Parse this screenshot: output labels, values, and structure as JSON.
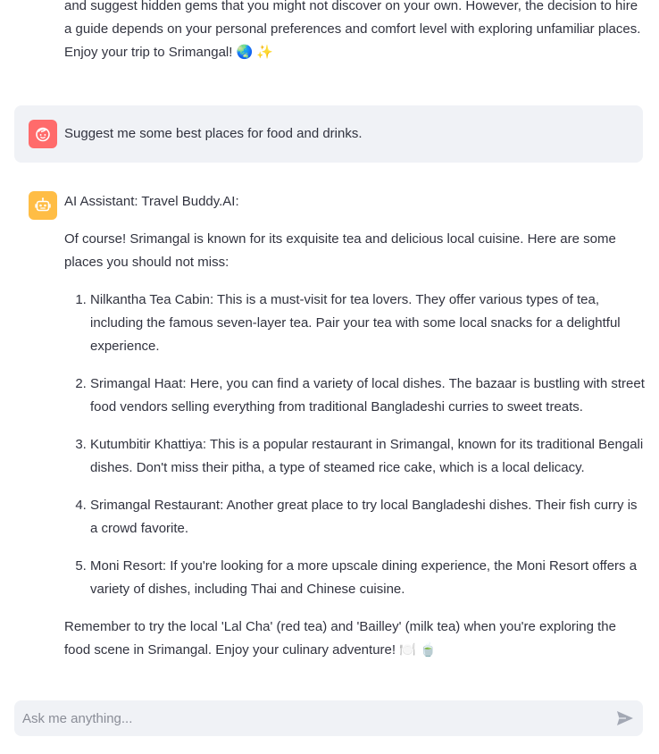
{
  "previous_message": {
    "lines": [
      "and suggest hidden gems that you might not discover on your own. However, the decision to hire",
      "a guide depends on your personal preferences and comfort level with exploring unfamiliar places.",
      "Enjoy your trip to Srimangal! 🌏 ✨"
    ]
  },
  "user_message": {
    "text": "Suggest me some best places for food and drinks.",
    "avatar_icon": "user-face-icon",
    "avatar_color": "#ff6b6b"
  },
  "assistant_message": {
    "avatar_icon": "robot-icon",
    "avatar_color": "#ffbd45",
    "header": "AI Assistant: Travel Buddy.AI:",
    "intro": "Of course! Srimangal is known for its exquisite tea and delicious local cuisine. Here are some places you should not miss:",
    "places": [
      "Nilkantha Tea Cabin: This is a must-visit for tea lovers. They offer various types of tea, including the famous seven-layer tea. Pair your tea with some local snacks for a delightful experience.",
      "Srimangal Haat: Here, you can find a variety of local dishes. The bazaar is bustling with street food vendors selling everything from traditional Bangladeshi curries to sweet treats.",
      "Kutumbitir Khattiya: This is a popular restaurant in Srimangal, known for its traditional Bengali dishes. Don't miss their pitha, a type of steamed rice cake, which is a local delicacy.",
      "Srimangal Restaurant: Another great place to try local Bangladeshi dishes. Their fish curry is a crowd favorite.",
      "Moni Resort: If you're looking for a more upscale dining experience, the Moni Resort offers a variety of dishes, including Thai and Chinese cuisine."
    ],
    "outro": "Remember to try the local 'Lal Cha' (red tea) and 'Bailley' (milk tea) when you're exploring the food scene in Srimangal. Enjoy your culinary adventure! 🍽️ 🍵"
  },
  "chat_input": {
    "placeholder": "Ask me anything...",
    "value": "",
    "send_icon": "send-icon"
  },
  "colors": {
    "background": "#ffffff",
    "text": "#31333f",
    "bubble": "#f0f2f6"
  }
}
